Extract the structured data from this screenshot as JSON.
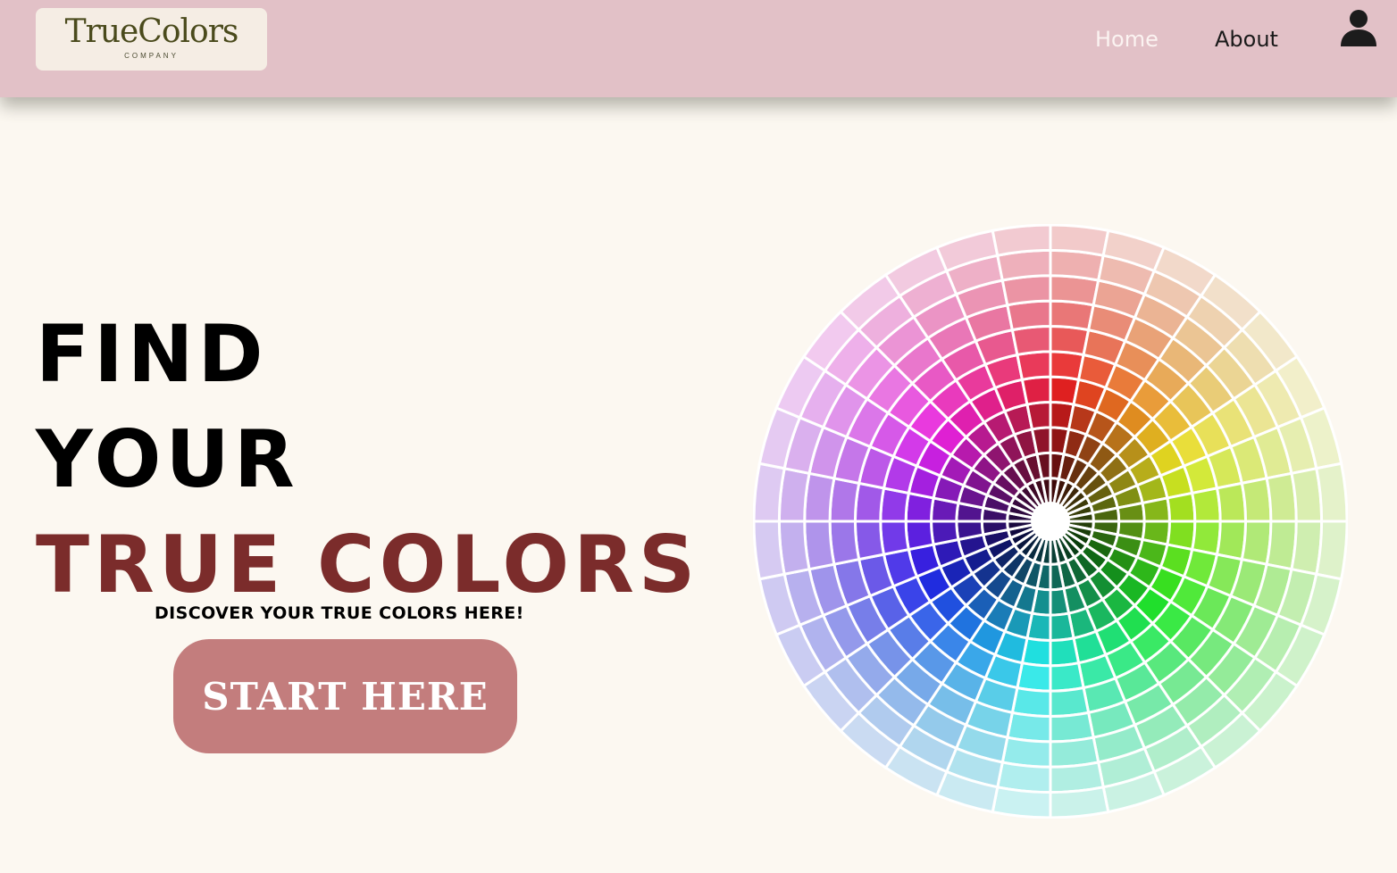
{
  "header": {
    "logo_text": "TrueColors",
    "logo_subtext": "COMPANY",
    "nav": [
      {
        "label": "Home"
      },
      {
        "label": "About"
      }
    ],
    "user_icon": "user-icon"
  },
  "hero": {
    "line1": "FIND",
    "line2": "YOUR",
    "line3": "TRUE COLORS",
    "subtitle": "DISCOVER YOUR TRUE COLORS HERE!",
    "cta_label": "START HERE"
  },
  "colors": {
    "header_bg": "#e2c1c7",
    "page_bg": "#fcf8f1",
    "accent_text": "#7b2c2b",
    "cta_bg": "#c37d7d"
  },
  "color_wheel": {
    "icon": "color-wheel",
    "segments": 32,
    "rings": 11
  }
}
